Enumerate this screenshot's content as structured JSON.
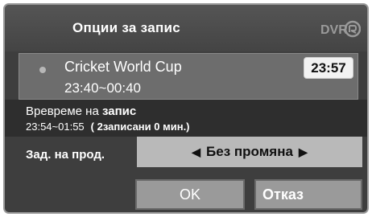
{
  "dialog": {
    "title": "Опции  за запис",
    "logo_text": "DVR",
    "program": {
      "name": "Cricket World Cup",
      "time": "23:40~00:40",
      "clock": "23:57"
    },
    "recording": {
      "label_prefix": "Вревреме на",
      "label_bold": " запис",
      "time": "23:54~01:55",
      "info": "( 2записани 0 мин.)"
    },
    "post_action": {
      "label": "Зад. на прод.",
      "value": "Без промяна",
      "left_arrow": "◀",
      "right_arrow": "▶"
    },
    "buttons": {
      "ok": "OK",
      "cancel": "Отказ"
    }
  }
}
